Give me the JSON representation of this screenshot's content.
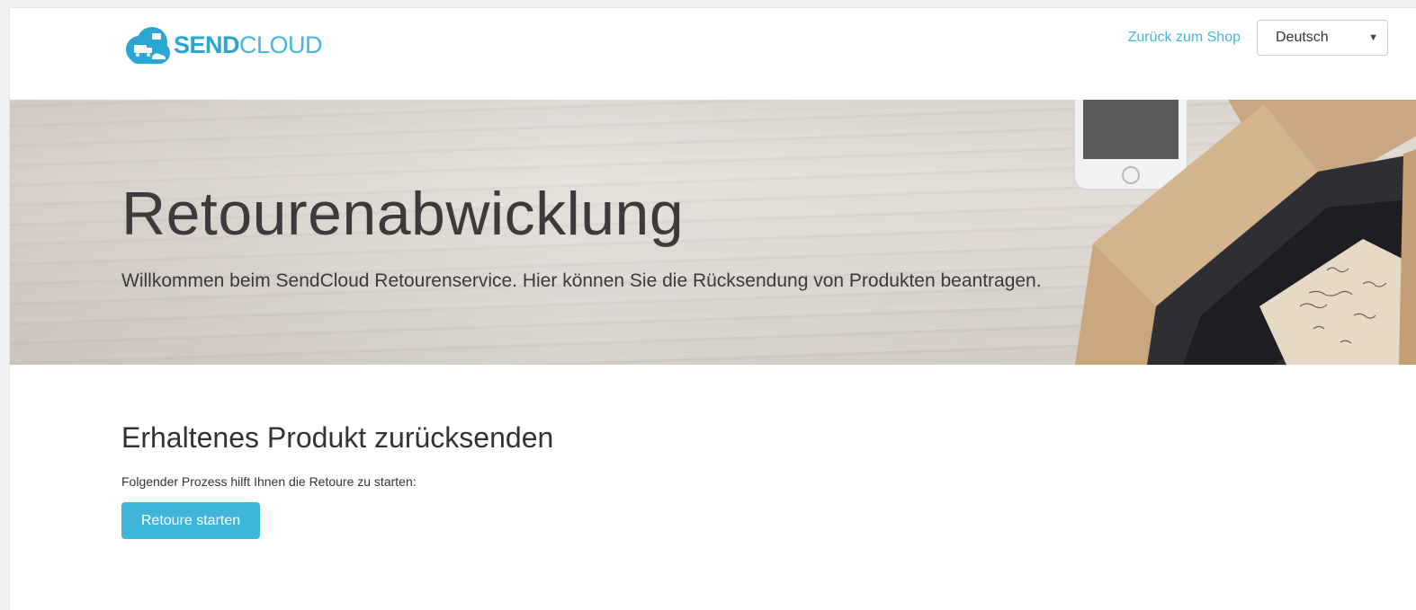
{
  "header": {
    "logo": {
      "bold": "SEND",
      "light": "CLOUD"
    },
    "back_link": "Zurück zum Shop",
    "language_select": {
      "selected": "Deutsch"
    }
  },
  "hero": {
    "title": "Retourenabwicklung",
    "subtitle": "Willkommen beim SendCloud Retourenservice. Hier können Sie die Rücksendung von Produkten beantragen."
  },
  "main": {
    "section_title": "Erhaltenes Produkt zurücksenden",
    "section_text": "Folgender Prozess hilft Ihnen die Retoure zu starten:",
    "start_button": "Retoure starten"
  },
  "colors": {
    "brand": "#2aa6d3",
    "button": "#3fb5dc",
    "link": "#46b8da"
  }
}
